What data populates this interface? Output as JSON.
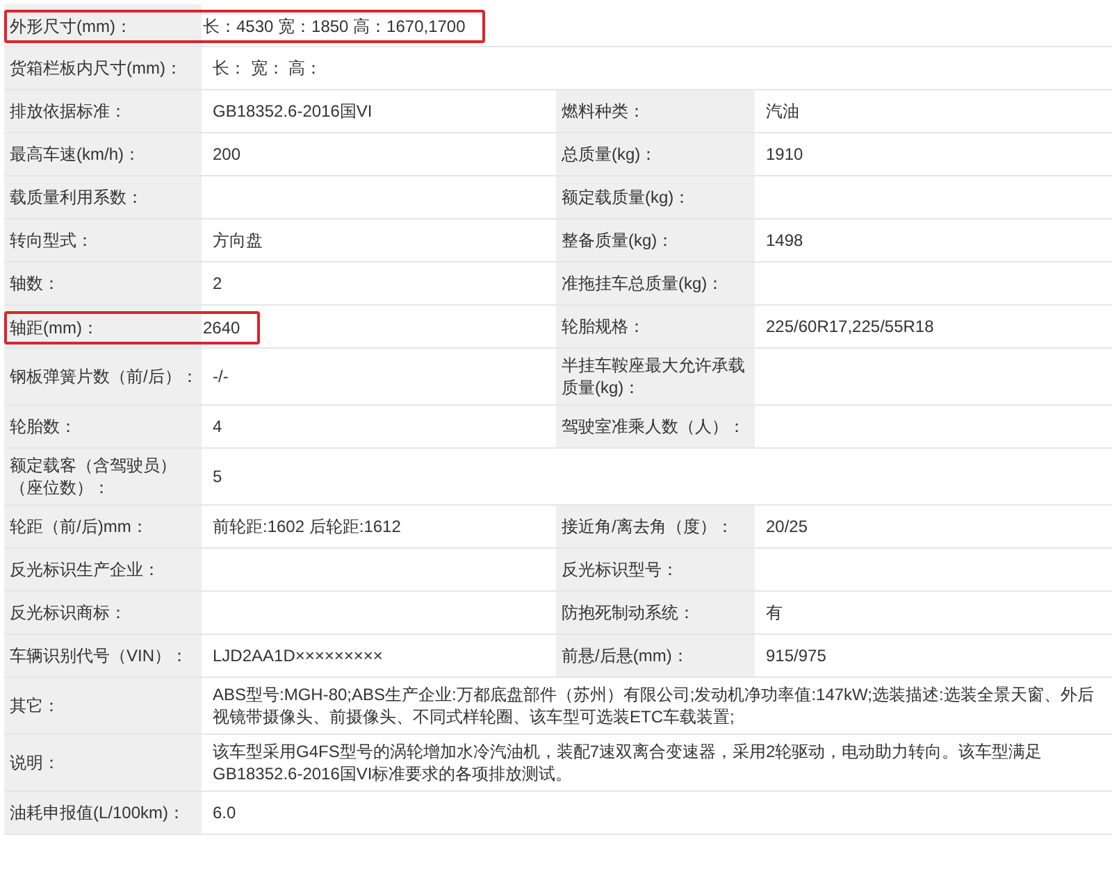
{
  "rows": [
    {
      "kind": "wide",
      "highlighted": true,
      "label": "外形尺寸(mm)：",
      "value": "长：4530 宽：1850 高：1670,1700"
    },
    {
      "kind": "wide",
      "highlighted": false,
      "label": "货箱栏板内尺寸(mm)：",
      "value": "长： 宽： 高："
    },
    {
      "kind": "pair",
      "highlighted": false,
      "label": "排放依据标准：",
      "value": "GB18352.6-2016国VI",
      "label2": "燃料种类：",
      "value2": "汽油"
    },
    {
      "kind": "pair",
      "highlighted": false,
      "label": "最高车速(km/h)：",
      "value": "200",
      "label2": "总质量(kg)：",
      "value2": "1910"
    },
    {
      "kind": "pair",
      "highlighted": false,
      "label": "载质量利用系数：",
      "label2": "额定载质量(kg)："
    },
    {
      "kind": "pair",
      "highlighted": false,
      "label": "转向型式：",
      "value": "方向盘",
      "label2": "整备质量(kg)：",
      "value2": "1498"
    },
    {
      "kind": "pair",
      "highlighted": false,
      "label": "轴数：",
      "value": "2",
      "label2": "准拖挂车总质量(kg)："
    },
    {
      "kind": "pair",
      "highlighted": true,
      "label": "轴距(mm)：",
      "value": "2640",
      "label2": "轮胎规格：",
      "value2": "225/60R17,225/55R18"
    },
    {
      "kind": "pair",
      "highlighted": false,
      "label": "钢板弹簧片数（前/后）：",
      "value": "-/-",
      "label2": "半挂车鞍座最大允许承载质量(kg)："
    },
    {
      "kind": "pair",
      "highlighted": false,
      "label": "轮胎数：",
      "value": "4",
      "label2": "驾驶室准乘人数（人）："
    },
    {
      "kind": "wide",
      "highlighted": false,
      "label": "额定载客（含驾驶员）（座位数）：",
      "value": "5"
    },
    {
      "kind": "pair",
      "highlighted": false,
      "label": "轮距（前/后)mm：",
      "value": "前轮距:1602 后轮距:1612",
      "label2": "接近角/离去角（度）：",
      "value2": "20/25"
    },
    {
      "kind": "pair",
      "highlighted": false,
      "label": "反光标识生产企业：",
      "label2": "反光标识型号："
    },
    {
      "kind": "pair",
      "highlighted": false,
      "label": "反光标识商标：",
      "label2": "防抱死制动系统：",
      "value2": "有"
    },
    {
      "kind": "pair",
      "highlighted": false,
      "label": "车辆识别代号（VIN）：",
      "value": "LJD2AA1D×××××××××",
      "label2": "前悬/后悬(mm)：",
      "value2": "915/975"
    },
    {
      "kind": "wide",
      "highlighted": false,
      "label": "其它：",
      "value": "ABS型号:MGH-80;ABS生产企业:万都底盘部件（苏州）有限公司;发动机净功率值:147kW;选装描述:选装全景天窗、外后视镜带摄像头、前摄像头、不同式样轮圈、该车型可选装ETC车载装置;"
    },
    {
      "kind": "wide",
      "highlighted": false,
      "label": "说明：",
      "value": "该车型采用G4FS型号的涡轮增加水冷汽油机，装配7速双离合变速器，采用2轮驱动，电动助力转向。该车型满足GB18352.6-2016国VI标准要求的各项排放测试。"
    },
    {
      "kind": "wide",
      "highlighted": false,
      "label": "油耗申报值(L/100km)：",
      "value": "6.0"
    }
  ]
}
